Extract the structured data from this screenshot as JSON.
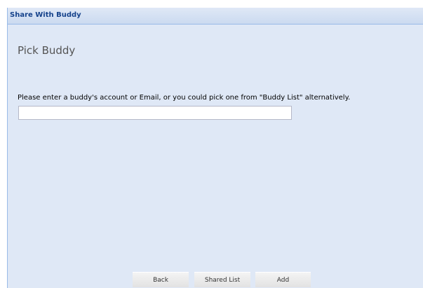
{
  "window": {
    "title": "Share With Buddy"
  },
  "main": {
    "heading": "Pick Buddy",
    "instruction": "Please enter a buddy's account or Email, or you could pick one from \"Buddy List\" alternatively.",
    "buddy_input": {
      "value": "",
      "placeholder": ""
    }
  },
  "footer": {
    "back_label": "Back",
    "shared_list_label": "Shared List",
    "add_label": "Add"
  },
  "colors": {
    "panel_background": "#dfe8f6",
    "title_text": "#15428b",
    "panel_border": "#99bbe8"
  }
}
